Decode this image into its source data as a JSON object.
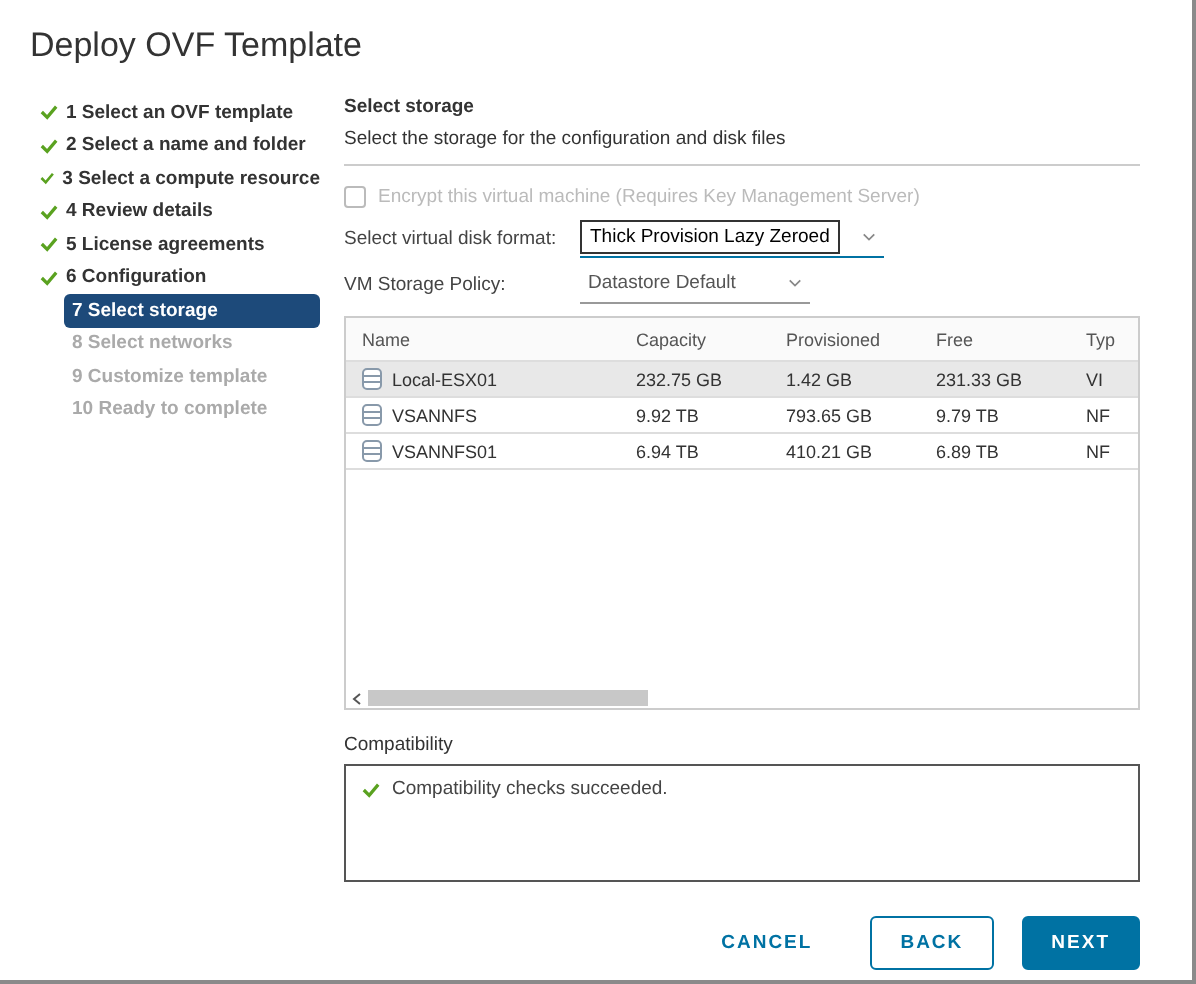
{
  "window": {
    "title": "Deploy OVF Template"
  },
  "steps": [
    {
      "label": "1 Select an OVF template",
      "completed": true,
      "selected": false,
      "disabled": false
    },
    {
      "label": "2 Select a name and folder",
      "completed": true,
      "selected": false,
      "disabled": false
    },
    {
      "label": "3 Select a compute resource",
      "completed": true,
      "selected": false,
      "disabled": false
    },
    {
      "label": "4 Review details",
      "completed": true,
      "selected": false,
      "disabled": false
    },
    {
      "label": "5 License agreements",
      "completed": true,
      "selected": false,
      "disabled": false
    },
    {
      "label": "6 Configuration",
      "completed": true,
      "selected": false,
      "disabled": false
    },
    {
      "label": "7 Select storage",
      "completed": false,
      "selected": true,
      "disabled": false
    },
    {
      "label": "8 Select networks",
      "completed": false,
      "selected": false,
      "disabled": true
    },
    {
      "label": "9 Customize template",
      "completed": false,
      "selected": false,
      "disabled": true
    },
    {
      "label": "10 Ready to complete",
      "completed": false,
      "selected": false,
      "disabled": true
    }
  ],
  "page": {
    "heading": "Select storage",
    "description": "Select the storage for the configuration and disk files"
  },
  "encrypt": {
    "label": "Encrypt this virtual machine (Requires Key Management Server)",
    "checked": false,
    "disabled": true
  },
  "disk_format": {
    "label": "Select virtual disk format:",
    "value": "Thick Provision Lazy Zeroed"
  },
  "storage_policy": {
    "label": "VM Storage Policy:",
    "value": "Datastore Default"
  },
  "table": {
    "columns": [
      "Name",
      "Capacity",
      "Provisioned",
      "Free",
      "Typ"
    ],
    "rows": [
      {
        "cells": [
          "Local-ESX01",
          "232.75 GB",
          "1.42 GB",
          "231.33 GB",
          "VI"
        ],
        "selected": true
      },
      {
        "cells": [
          "VSANNFS",
          "9.92 TB",
          "793.65 GB",
          "9.79 TB",
          "NF"
        ],
        "selected": false
      },
      {
        "cells": [
          "VSANNFS01",
          "6.94 TB",
          "410.21 GB",
          "6.89 TB",
          "NF"
        ],
        "selected": false
      }
    ]
  },
  "compatibility": {
    "label": "Compatibility",
    "message": "Compatibility checks succeeded.",
    "ok": true
  },
  "buttons": [
    {
      "label": "CANCEL",
      "kind": "link"
    },
    {
      "label": "BACK",
      "kind": "outline"
    },
    {
      "label": "NEXT",
      "kind": "primary"
    }
  ]
}
